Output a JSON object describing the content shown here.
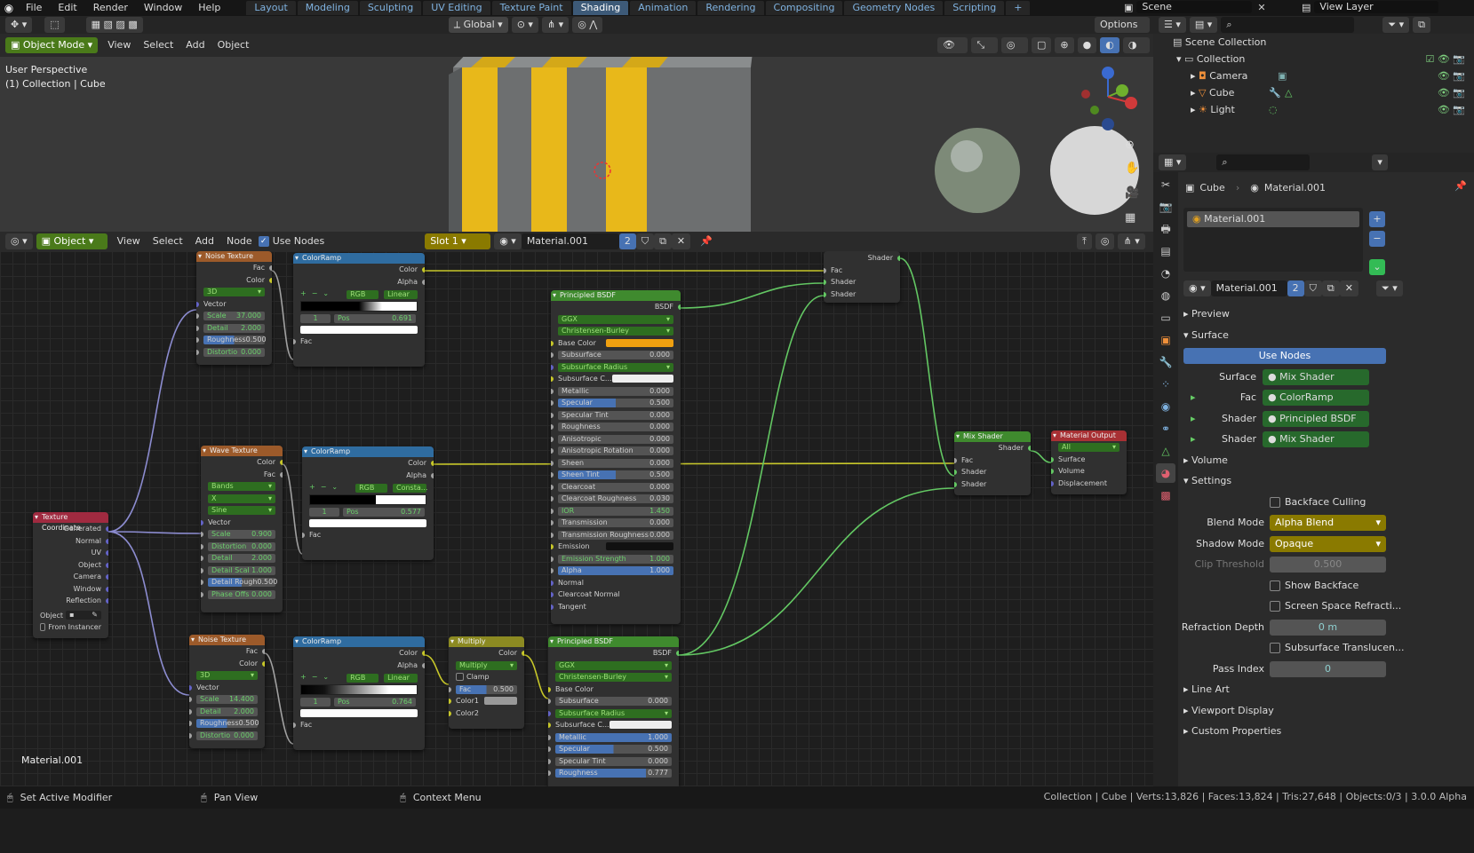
{
  "topbar": {
    "menus": [
      "File",
      "Edit",
      "Render",
      "Window",
      "Help"
    ],
    "workspaces": [
      "Layout",
      "Modeling",
      "Sculpting",
      "UV Editing",
      "Texture Paint",
      "Shading",
      "Animation",
      "Rendering",
      "Compositing",
      "Geometry Nodes",
      "Scripting"
    ],
    "active_workspace": "Shading",
    "scene": "Scene",
    "view_layer": "View Layer"
  },
  "viewport": {
    "mode": "Object Mode",
    "menus": [
      "View",
      "Select",
      "Add",
      "Object"
    ],
    "orientation": "Global",
    "options": "Options",
    "info_line1": "User Perspective",
    "info_line2": "(1) Collection | Cube"
  },
  "node_editor": {
    "mode": "Object",
    "menus": [
      "View",
      "Select",
      "Add",
      "Node"
    ],
    "use_nodes": "Use Nodes",
    "slot": "Slot 1",
    "material": "Material.001",
    "users": "2",
    "material_label": "Material.001"
  },
  "nodes": {
    "noise1": {
      "title": "Noise Texture",
      "out": [
        "Fac",
        "Color"
      ],
      "dim": "3D",
      "vector": "Vector",
      "fields": [
        [
          "Scale",
          "37.000"
        ],
        [
          "Detail",
          "2.000"
        ],
        [
          "Roughness",
          "0.500"
        ],
        [
          "Distortio",
          "0.000"
        ]
      ]
    },
    "ramp1": {
      "title": "ColorRamp",
      "out": [
        "Color",
        "Alpha"
      ],
      "mode": "RGB",
      "interp": "Linear",
      "idx": "1",
      "pos_label": "Pos",
      "pos": "0.691",
      "fac": "Fac"
    },
    "wave": {
      "title": "Wave Texture",
      "out": [
        "Color",
        "Fac"
      ],
      "opts": [
        "Bands",
        "X",
        "Sine"
      ],
      "vector": "Vector",
      "fields": [
        [
          "Scale",
          "0.900"
        ],
        [
          "Distortion",
          "0.000"
        ],
        [
          "Detail",
          "2.000"
        ],
        [
          "Detail Scal",
          "1.000"
        ],
        [
          "Detail Rough",
          "0.500"
        ],
        [
          "Phase Offs",
          "0.000"
        ]
      ]
    },
    "ramp2": {
      "title": "ColorRamp",
      "out": [
        "Color",
        "Alpha"
      ],
      "mode": "RGB",
      "interp": "Consta...",
      "idx": "1",
      "pos_label": "Pos",
      "pos": "0.577",
      "fac": "Fac"
    },
    "texcoord": {
      "title": "Texture Coordinate",
      "out": [
        "Generated",
        "Normal",
        "UV",
        "Object",
        "Camera",
        "Window",
        "Reflection"
      ],
      "object": "Object",
      "from_instancer": "From Instancer"
    },
    "noise2": {
      "title": "Noise Texture",
      "out": [
        "Fac",
        "Color"
      ],
      "dim": "3D",
      "vector": "Vector",
      "fields": [
        [
          "Scale",
          "14.400"
        ],
        [
          "Detail",
          "2.000"
        ],
        [
          "Roughness",
          "0.500"
        ],
        [
          "Distortio",
          "0.000"
        ]
      ]
    },
    "ramp3": {
      "title": "ColorRamp",
      "out": [
        "Color",
        "Alpha"
      ],
      "mode": "RGB",
      "interp": "Linear",
      "idx": "1",
      "pos_label": "Pos",
      "pos": "0.764",
      "fac": "Fac"
    },
    "multiply": {
      "title": "Multiply",
      "out": "Color",
      "blend": "Multiply",
      "clamp": "Clamp",
      "fac_label": "Fac",
      "fac": "0.500",
      "color1": "Color1",
      "color2": "Color2"
    },
    "bsdf1": {
      "title": "Principled BSDF",
      "out": "BSDF",
      "dist": "GGX",
      "sss": "Christensen-Burley",
      "base": "Base Color",
      "rows": [
        [
          "Subsurface",
          "0.000"
        ],
        [
          "Subsurface Radius",
          ""
        ],
        [
          "Subsurface C...",
          ""
        ],
        [
          "Metallic",
          "0.000"
        ],
        [
          "Specular",
          "0.500"
        ],
        [
          "Specular Tint",
          "0.000"
        ],
        [
          "Roughness",
          "0.000"
        ],
        [
          "Anisotropic",
          "0.000"
        ],
        [
          "Anisotropic Rotation",
          "0.000"
        ],
        [
          "Sheen",
          "0.000"
        ],
        [
          "Sheen Tint",
          "0.500"
        ],
        [
          "Clearcoat",
          "0.000"
        ],
        [
          "Clearcoat Roughness",
          "0.030"
        ],
        [
          "IOR",
          "1.450"
        ],
        [
          "Transmission",
          "0.000"
        ],
        [
          "Transmission Roughness",
          "0.000"
        ],
        [
          "Emission",
          ""
        ],
        [
          "Emission Strength",
          "1.000"
        ],
        [
          "Alpha",
          "1.000"
        ],
        [
          "Normal",
          ""
        ],
        [
          "Clearcoat Normal",
          ""
        ],
        [
          "Tangent",
          ""
        ]
      ]
    },
    "bsdf2": {
      "title": "Principled BSDF",
      "out": "BSDF",
      "dist": "GGX",
      "sss": "Christensen-Burley",
      "base": "Base Color",
      "rows": [
        [
          "Subsurface",
          "0.000"
        ],
        [
          "Subsurface Radius",
          ""
        ],
        [
          "Subsurface C...",
          ""
        ],
        [
          "Metallic",
          "1.000"
        ],
        [
          "Specular",
          "0.500"
        ],
        [
          "Specular Tint",
          "0.000"
        ],
        [
          "Roughness",
          "0.777"
        ]
      ]
    },
    "mix1": {
      "out": "Shader",
      "ins": [
        "Fac",
        "Shader",
        "Shader"
      ]
    },
    "mix2": {
      "title": "Mix Shader",
      "out": "Shader",
      "ins": [
        "Fac",
        "Shader",
        "Shader"
      ]
    },
    "output": {
      "title": "Material Output",
      "target": "All",
      "ins": [
        "Surface",
        "Volume",
        "Displacement"
      ]
    }
  },
  "outliner": {
    "scene_collection": "Scene Collection",
    "collection": "Collection",
    "items": [
      "Camera",
      "Cube",
      "Light"
    ]
  },
  "properties": {
    "object": "Cube",
    "material": "Material.001",
    "slot_item": "Material.001",
    "mat_field": "Material.001",
    "users": "2",
    "preview": "Preview",
    "surface_panel": "Surface",
    "use_nodes": "Use Nodes",
    "surface": {
      "label": "Surface",
      "value": "Mix Shader"
    },
    "fac": {
      "label": "Fac",
      "value": "ColorRamp"
    },
    "shader1": {
      "label": "Shader",
      "value": "Principled BSDF"
    },
    "shader2": {
      "label": "Shader",
      "value": "Mix Shader"
    },
    "volume": "Volume",
    "settings": "Settings",
    "backface_culling": "Backface Culling",
    "blend_mode": {
      "label": "Blend Mode",
      "value": "Alpha Blend"
    },
    "shadow_mode": {
      "label": "Shadow Mode",
      "value": "Opaque"
    },
    "clip_threshold": {
      "label": "Clip Threshold",
      "value": "0.500"
    },
    "show_backface": "Show Backface",
    "ssr": "Screen Space Refracti...",
    "refraction_depth": {
      "label": "Refraction Depth",
      "value": "0 m"
    },
    "subsurface_translucency": "Subsurface Translucen...",
    "pass_index": {
      "label": "Pass Index",
      "value": "0"
    },
    "line_art": "Line Art",
    "viewport_display": "Viewport Display",
    "custom_props": "Custom Properties"
  },
  "statusbar": {
    "left1": "Set Active Modifier",
    "left2": "Pan View",
    "left3": "Context Menu",
    "right": "Collection | Cube | Verts:13,826 | Faces:13,824 | Tris:27,648 | Objects:0/3 | 3.0.0 Alpha"
  },
  "colors": {
    "yellow_stripe": "#e8b81a",
    "accent_blue": "#4772b3",
    "node_wire": "#9a9ad0",
    "base_color": "#f0a010"
  }
}
